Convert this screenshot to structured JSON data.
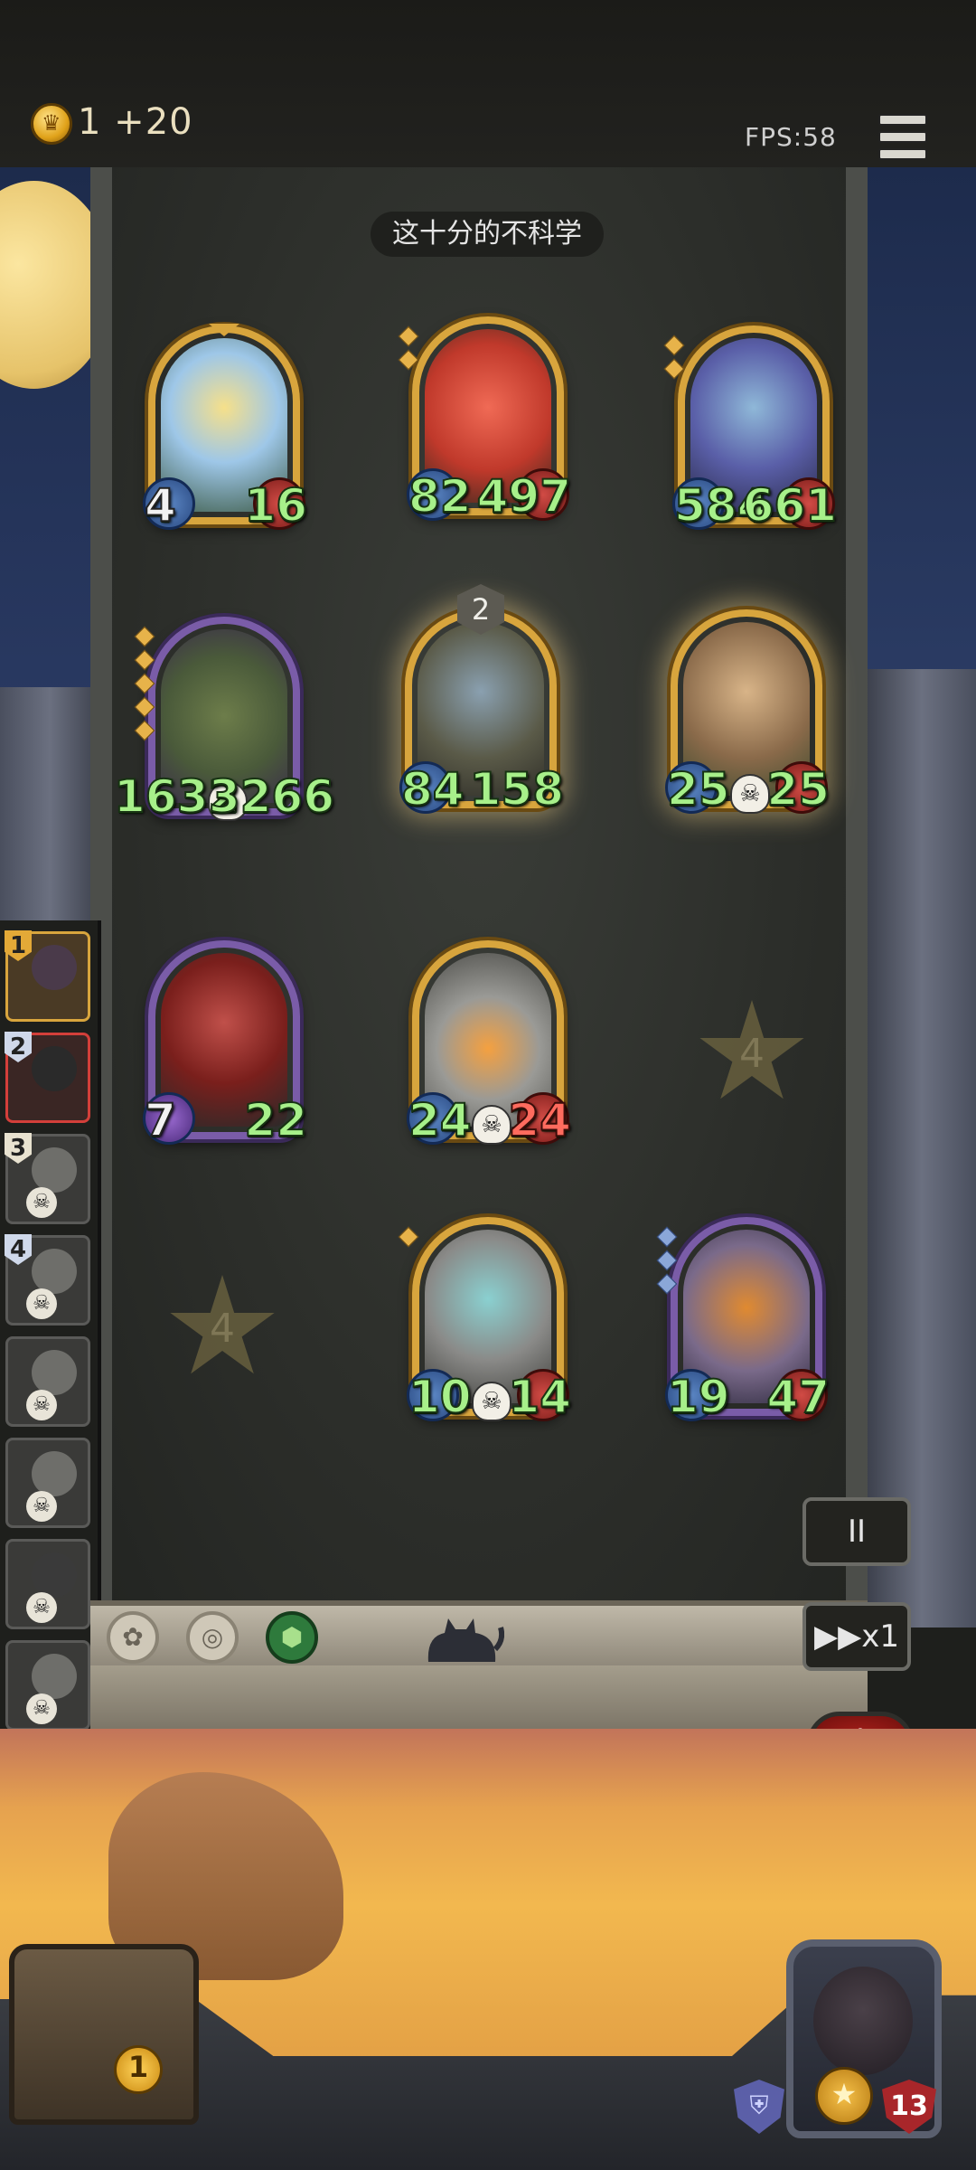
{
  "topbar": {
    "gold_value": "1",
    "gold_income": "+20",
    "fps": "FPS:58",
    "menu_icon": "hamburger-menu-icon"
  },
  "board": {
    "title": "这十分的不科学",
    "chalk_marks": [
      "4",
      "4"
    ]
  },
  "cards": [
    {
      "id": "fairy",
      "atk": "4",
      "hp": "16",
      "frame": "gold"
    },
    {
      "id": "red-ogre",
      "atk": "82",
      "hp": "497",
      "frame": "gold"
    },
    {
      "id": "elf-sorceress",
      "atk": "584",
      "hp": "661",
      "frame": "gold"
    },
    {
      "id": "rock-golem",
      "atk": "1632",
      "hp": "3266",
      "frame": "purple"
    },
    {
      "id": "mushroom-spider",
      "atk": "84",
      "hp": "158",
      "frame": "gold",
      "level": "2"
    },
    {
      "id": "flower-lady",
      "atk": "25",
      "hp": "25",
      "frame": "gold"
    },
    {
      "id": "hooded-assassin",
      "atk": "7",
      "hp": "22",
      "frame": "purple"
    },
    {
      "id": "windup-robot",
      "atk": "24",
      "hp": "24",
      "frame": "gold"
    },
    {
      "id": "lamp-robot",
      "atk": "10",
      "hp": "14",
      "frame": "gold"
    },
    {
      "id": "pumpkin-knight",
      "atk": "19",
      "hp": "47",
      "frame": "purple"
    }
  ],
  "queue": [
    "1",
    "2",
    "3",
    "4",
    "",
    "",
    "",
    ""
  ],
  "controls": {
    "pause_label": "II",
    "speed_label": "▶▶x1",
    "power_icon": "power-icon"
  },
  "footer": {
    "chest_count": "1",
    "hero_hp": "13",
    "colors": {
      "accent_gold": "#d8a53d",
      "hp_red": "#a8262a",
      "stat_green": "#a7f08a"
    }
  }
}
